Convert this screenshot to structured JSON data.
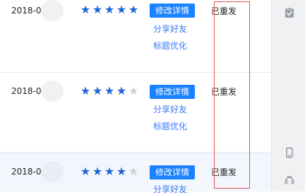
{
  "rows": [
    {
      "date": "2018-0",
      "stars_filled": 5,
      "stars_total": 5,
      "edit_label": "修改详情",
      "share_label": "分享好友",
      "optimize_label": "标题优化",
      "status": "已重发"
    },
    {
      "date": "2018-0",
      "stars_filled": 4,
      "stars_total": 5,
      "edit_label": "修改详情",
      "share_label": "分享好友",
      "optimize_label": "标题优化",
      "status": "已重发"
    },
    {
      "date": "2018-0",
      "stars_filled": 4,
      "stars_total": 5,
      "edit_label": "修改详情",
      "share_label": "分享好友",
      "status": "已重发"
    }
  ],
  "side_icons": [
    "clipboard-check-icon",
    "phone-icon",
    "customer-service-icon"
  ],
  "colors": {
    "accent": "#1a82ff",
    "link": "#3579f6",
    "star_on": "#1c66d6",
    "star_off": "#cfcfcf",
    "outline": "#e05252"
  }
}
